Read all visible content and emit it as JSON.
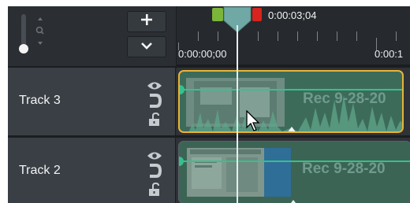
{
  "header": {
    "zoom_slider_label": "Zoom",
    "add_track_icon": "plus-icon",
    "more_options_icon": "chevron-down-icon"
  },
  "ruler": {
    "playhead_time": "0:00:03;04",
    "time_start": "0:00:00;00",
    "time_next": "0:00:1"
  },
  "tracks": [
    {
      "name": "Track 3",
      "icons": [
        "eye-icon",
        "magnet-icon",
        "lock-icon"
      ],
      "clip": {
        "title": "Rec 9-28-20",
        "selected": true
      }
    },
    {
      "name": "Track 2",
      "icons": [
        "eye-icon",
        "magnet-icon",
        "lock-icon"
      ],
      "clip": {
        "title": "Rec 9-28-20",
        "selected": false
      }
    }
  ],
  "colors": {
    "accent_selected": "#e7b437",
    "clip_green": "#37c08d",
    "marker_in": "#7bb53a",
    "marker_out": "#d8241e",
    "playhead": "#6fa8a4"
  }
}
